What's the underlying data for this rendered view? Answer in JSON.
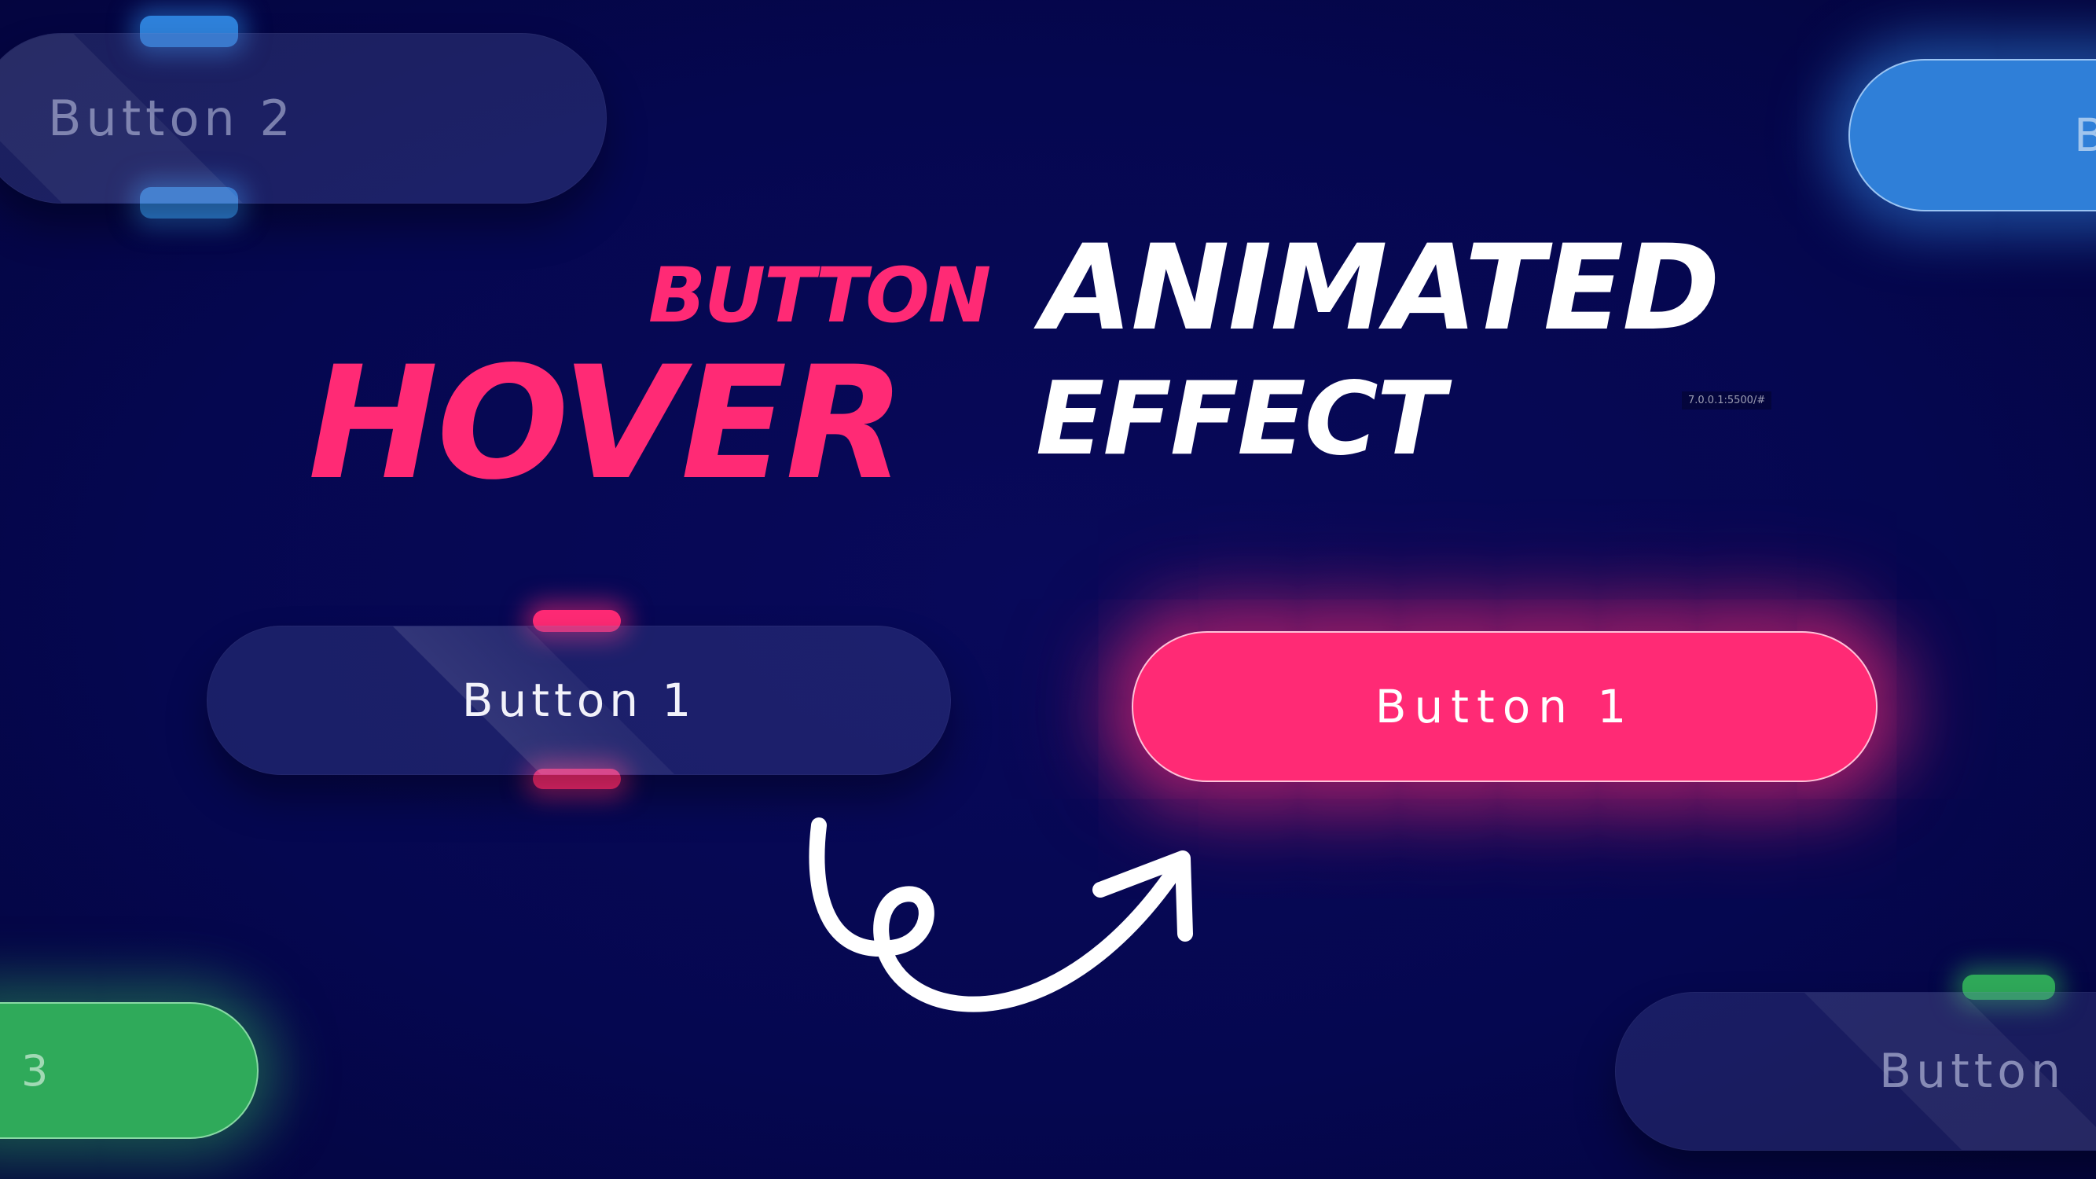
{
  "colors": {
    "background": "#050750",
    "accent_pink": "#ff2a75",
    "accent_blue": "#2f7fd8",
    "accent_green": "#2faa5a",
    "text_white": "#ffffff"
  },
  "headline": {
    "word_button": "BUTTON",
    "word_animated": "ANIMATED",
    "word_hover": "HOVER",
    "word_effect": "EFFECT"
  },
  "browser": {
    "url": "7.0.0.1:5500/#"
  },
  "buttons": {
    "top_left_label": "Button 2",
    "top_right_label": "B",
    "main_default_label": "Button 1",
    "main_hover_label": "Button 1",
    "bottom_left_label": "3",
    "bottom_right_label": "Button"
  },
  "icons": {
    "arrow": "curly-arrow-icon"
  }
}
